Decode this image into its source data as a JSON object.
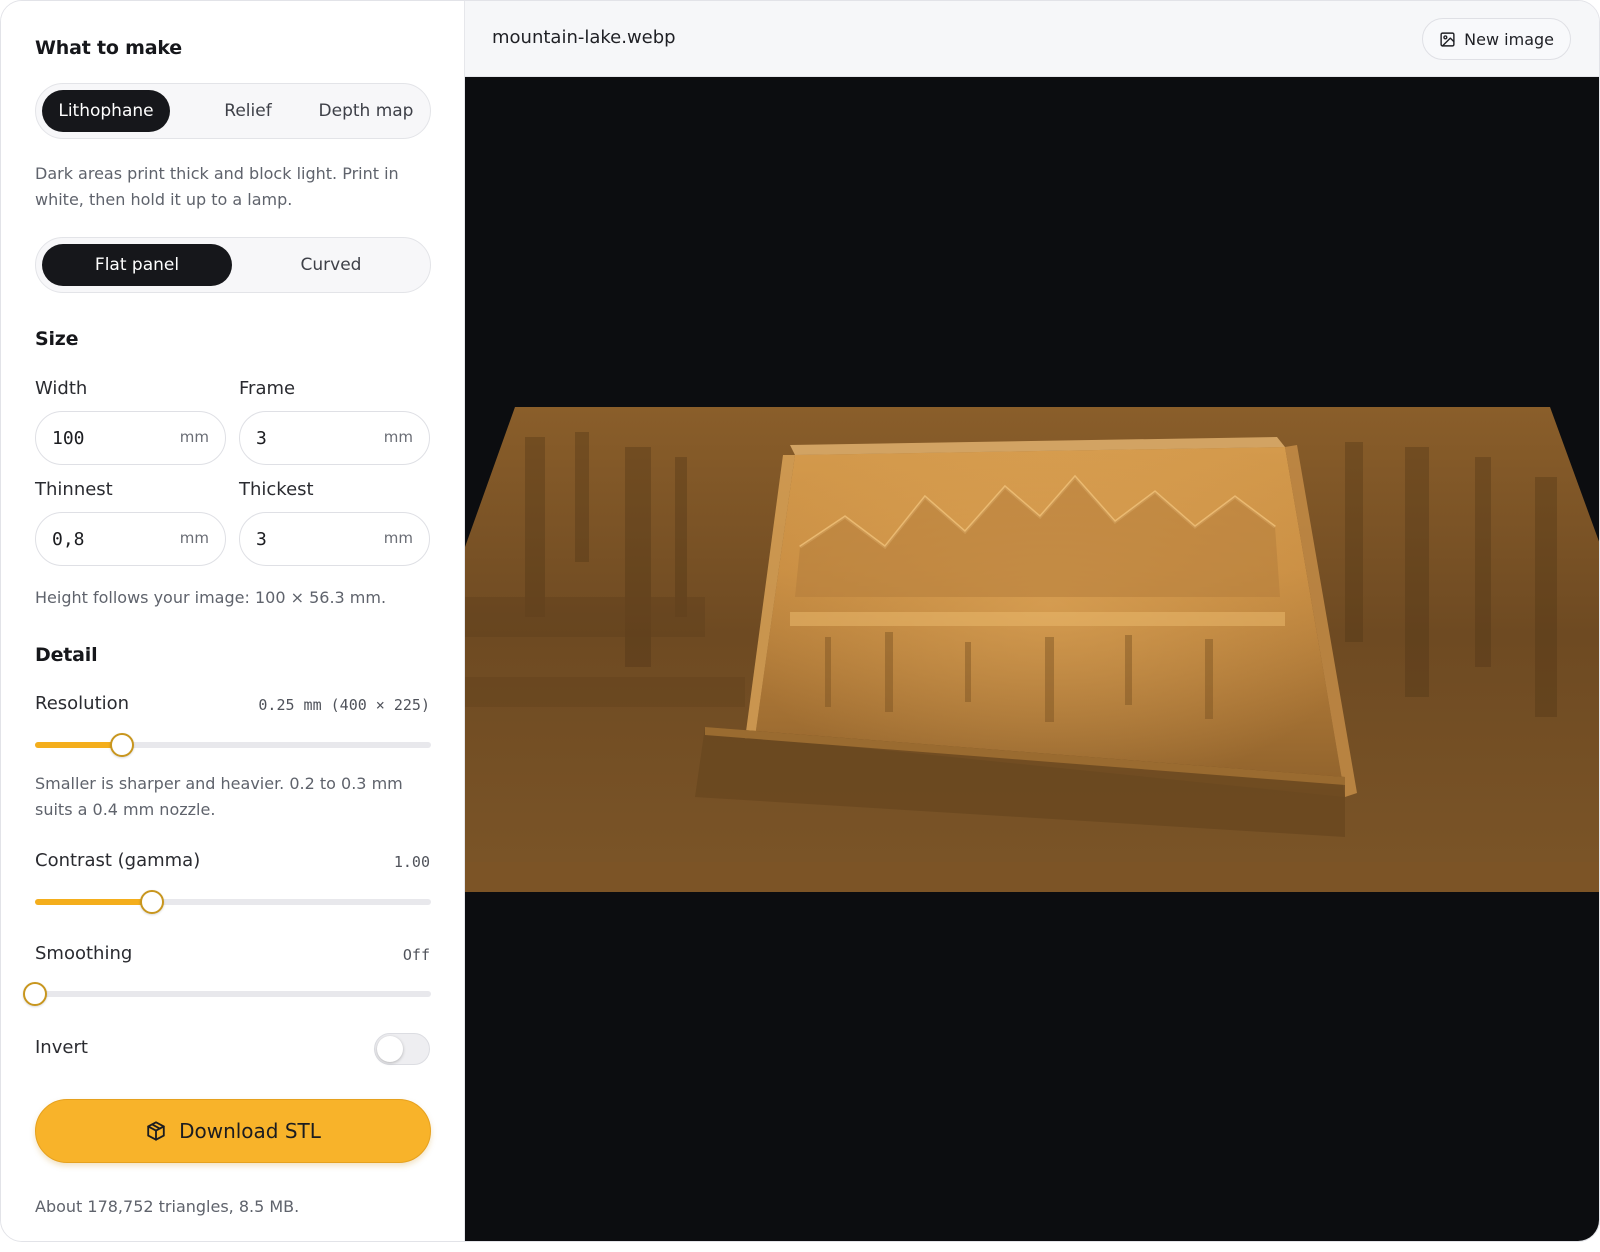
{
  "sidebar": {
    "heading": "What to make",
    "mode_tabs": [
      {
        "label": "Lithophane",
        "active": true
      },
      {
        "label": "Relief",
        "active": false
      },
      {
        "label": "Depth map",
        "active": false
      }
    ],
    "mode_description": "Dark areas print thick and block light. Print in white, then hold it up to a lamp.",
    "shape_tabs": [
      {
        "label": "Flat panel",
        "active": true
      },
      {
        "label": "Curved",
        "active": false
      }
    ],
    "size": {
      "title": "Size",
      "width": {
        "label": "Width",
        "value": "100",
        "unit": "mm"
      },
      "frame": {
        "label": "Frame",
        "value": "3",
        "unit": "mm"
      },
      "thinnest": {
        "label": "Thinnest",
        "value": "0,8",
        "unit": "mm"
      },
      "thickest": {
        "label": "Thickest",
        "value": "3",
        "unit": "mm"
      },
      "note": "Height follows your image: 100 × 56.3 mm."
    },
    "detail": {
      "title": "Detail",
      "resolution": {
        "label": "Resolution",
        "value_text": "0.25 mm (400 × 225)",
        "fraction": 0.22,
        "hint": "Smaller is sharper and heavier. 0.2 to 0.3 mm suits a 0.4 mm nozzle."
      },
      "contrast": {
        "label": "Contrast (gamma)",
        "value_text": "1.00",
        "fraction": 0.295
      },
      "smoothing": {
        "label": "Smoothing",
        "value_text": "Off",
        "fraction": 0.0
      }
    },
    "invert": {
      "label": "Invert",
      "on": false
    },
    "download": {
      "label": "Download STL",
      "icon": "cube-icon"
    },
    "stats": "About 178,752 triangles, 8.5 MB."
  },
  "preview": {
    "filename": "mountain-lake.webp",
    "new_image_label": "New image",
    "new_image_icon": "image-icon",
    "model_color": "#b07a34",
    "background_color": "#0c0d10"
  },
  "colors": {
    "accent": "#f8b32a",
    "dark": "#16171b"
  }
}
